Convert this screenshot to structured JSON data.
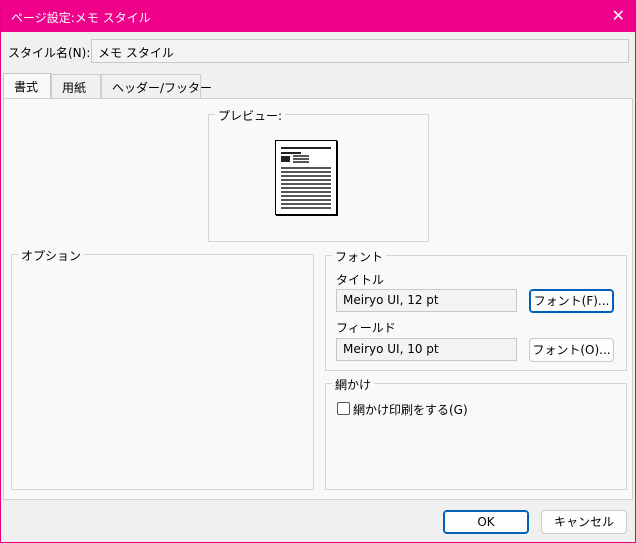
{
  "window": {
    "title": "ページ設定:メモ スタイル"
  },
  "style_name": {
    "label": "スタイル名(N):",
    "value": "メモ スタイル"
  },
  "tabs": [
    {
      "label": "書式"
    },
    {
      "label": "用紙"
    },
    {
      "label": "ヘッダー/フッター"
    }
  ],
  "preview": {
    "title": "プレビュー:"
  },
  "options": {
    "title": "オプション"
  },
  "font": {
    "title": "フォント",
    "title_font_label": "タイトル",
    "title_font_value": "Meiryo UI, 12 pt",
    "title_font_button": "フォント(F)...",
    "field_font_label": "フィールド",
    "field_font_value": "Meiryo UI, 10 pt",
    "field_font_button": "フォント(O)..."
  },
  "shading": {
    "title": "網かけ",
    "checkbox_label": "網かけ印刷をする(G)",
    "checked": false
  },
  "footer": {
    "ok": "OK",
    "cancel": "キャンセル"
  },
  "colors": {
    "titlebar": "#f0018a",
    "accent": "#005fb8"
  }
}
